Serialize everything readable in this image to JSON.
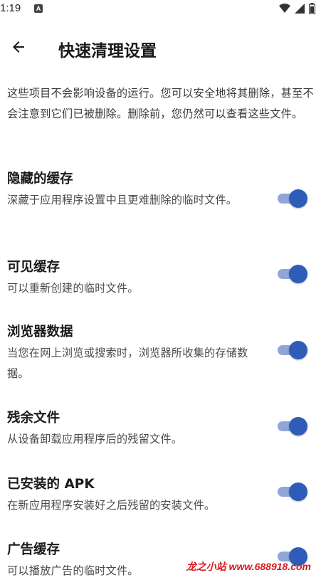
{
  "status_bar": {
    "time": "1:19",
    "notification_glyph": "A",
    "icons": [
      "notification-a-icon",
      "wifi-icon",
      "signal-icon",
      "battery-icon"
    ]
  },
  "app_bar": {
    "back_icon": "arrow-back-icon",
    "title": "快速清理设置"
  },
  "description": "这些项目不会影响设备的运行。您可以安全地将其删除，甚至不会注意到它们已被删除。删除前，您仍然可以查看这些文件。",
  "settings": [
    {
      "title": "隐藏的缓存",
      "description": "深藏于应用程序设置中且更难删除的临时文件。",
      "enabled": true
    },
    {
      "title": "可见缓存",
      "description": "可以重新创建的临时文件。",
      "enabled": true
    },
    {
      "title": "浏览器数据",
      "description": "当您在网上浏览或搜索时，浏览器所收集的存储数据。",
      "enabled": true
    },
    {
      "title": "残余文件",
      "description": "从设备卸载应用程序后的残留文件。",
      "enabled": true
    },
    {
      "title": "已安装的 APK",
      "description": "在新应用程序安装好之后残留的安装文件。",
      "enabled": true
    },
    {
      "title": "广告缓存",
      "description": "可以播放广告的临时文件。",
      "enabled": true
    }
  ],
  "watermark": "龙之小站 www.688918.com",
  "colors": {
    "toggle_thumb": "#2f5cb8",
    "toggle_track": "#8fa6d6",
    "watermark": "#d6181f"
  }
}
